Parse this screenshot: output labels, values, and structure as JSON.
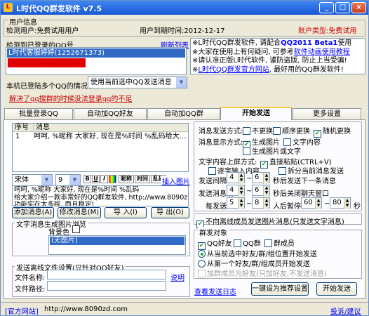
{
  "window": {
    "title": "L时代QQ群发软件 v7.5",
    "minimize": "_",
    "maximize": "□",
    "close": "×"
  },
  "user_info": {
    "section_title": "用户信息",
    "login_user": "检测用户:免费试用用户",
    "expiry": "用户到期时间:2012-12-17",
    "account_type": "账户类型:免费试用"
  },
  "qq_list": {
    "label": "检测到已登录的QQ号",
    "refresh_link": "刷新列表",
    "items": [
      "L时代客服婷婷(1252671373)"
    ],
    "redacted_item": "████████████"
  },
  "notice": {
    "line1_prefix": "※L时代QQ群发软件, 请配合",
    "line1_link": "QQ2011 Beta1",
    "line1_suffix": "使用",
    "line2_prefix": "※大家在使用上有何疑问, 可参考",
    "line2_link": "软件动画使用教程",
    "line3": "※请认准正版L时代软件, 谨防盗版, 防止上当受骗!",
    "line4_prefix": "※",
    "line4_link": "L时代QQ群发官方网站",
    "line4_suffix": ", 最好用的QQ群发软件!"
  },
  "multi_qq": {
    "label": "本机已登陆多个QQ的情况下",
    "selected": "使用当前选中QQ发送消息"
  },
  "fix_link": "解决了qq搜群的时候没法登录qq的不足",
  "tabs": [
    "批量登录QQ",
    "自动加QQ好友",
    "自动加QQ群",
    "开始发送",
    "更多设置"
  ],
  "active_tab": "开始发送",
  "message_table": {
    "headers": [
      "序号",
      "消息"
    ],
    "rows": [
      {
        "index": "1",
        "message": "呵呵, %昵称 大家好, 现在是%时间 %乱码给大…"
      }
    ]
  },
  "editor": {
    "font": "宋体",
    "size": "9",
    "bold": "B",
    "underline": "U",
    "italic": "I",
    "nickname_btn": "昵称",
    "time_btn": "时间",
    "random_btn": "乱码",
    "insert_image": "插入图片",
    "content": "呵呵, %昵称 大家好, 现在是%时间 %乱码\n给大家介绍一款非常好的QQ群发软件, http://www.8090z\n功能实在太多啦, 而且稳定!"
  },
  "message_buttons": {
    "add": "添加消息(A)",
    "modify": "修改消息(M)",
    "import": "导 入(I)",
    "export": "导 出(O)"
  },
  "image_gen": {
    "title": "文字消息生成图片浏览",
    "bgcolor_label": "背景色",
    "no_image": "(无图片)"
  },
  "offline_file": {
    "title": "发送离线文件设置(只针对QQ好友)",
    "file_name_label": "文件名称:",
    "file_path_label": "文件路径:",
    "help_link": "说明"
  },
  "send_settings": {
    "send_mode_label": "消息发送方式:",
    "send_mode_options": [
      {
        "label": "不更换",
        "checked": false
      },
      {
        "label": "顺序更换",
        "checked": false
      },
      {
        "label": "随机更换",
        "checked": true
      }
    ],
    "display_mode_label": "消息显示方式:",
    "display_mode_options": [
      {
        "label": "生成图片",
        "checked": true
      },
      {
        "label": "文字内容",
        "checked": false
      },
      {
        "label": "生成图片或文字",
        "checked": false
      }
    ],
    "screen_mode_label": "文字内容上屏方式:",
    "screen_mode_options": [
      {
        "label": "直接粘贴(CTRL+V)",
        "checked": true
      },
      {
        "label": "逐字输入内容",
        "checked": false
      },
      {
        "label": "拆分当前消息发送",
        "checked": false
      }
    ],
    "interval_label": "发送间隔",
    "interval_from": "4",
    "interval_to": "6",
    "interval_suffix": "秒后发送下一条消息",
    "close_label": "发送消息后",
    "close_from": "4",
    "close_to": "6",
    "close_suffix": "秒后关闭聊天窗口",
    "pause_prefix": "每发送",
    "pause_from": "5",
    "pause_to": "8",
    "pause_mid": "人后暂停",
    "pause_sec_from": "60",
    "pause_sec_to": "80",
    "pause_suffix": "秒",
    "offline_only_label": "不向离线成员发送图片消息(只发送文字消息)",
    "offline_only_checked": true,
    "target_title": "群发对象",
    "targets": [
      {
        "label": "QQ好友",
        "checked": true
      },
      {
        "label": "QQ群",
        "checked": false
      },
      {
        "label": "群成员",
        "checked": false
      }
    ],
    "start_options": [
      {
        "label": "从当前选中好友/群/组位置开始发送",
        "checked": true
      },
      {
        "label": "从第一个好友/群/组成员开始发送",
        "checked": false
      }
    ],
    "friend_member_label": "加群成员为好友(只加好友,不发送消息)",
    "log_link": "查看发送日志",
    "recommend_btn": "一键设为推荐设置",
    "start_btn": "开始发送"
  },
  "footer": {
    "site_label": "[官方网站]",
    "site_url": "http://www.8090zd.com",
    "feedback": "投诉/建议"
  }
}
